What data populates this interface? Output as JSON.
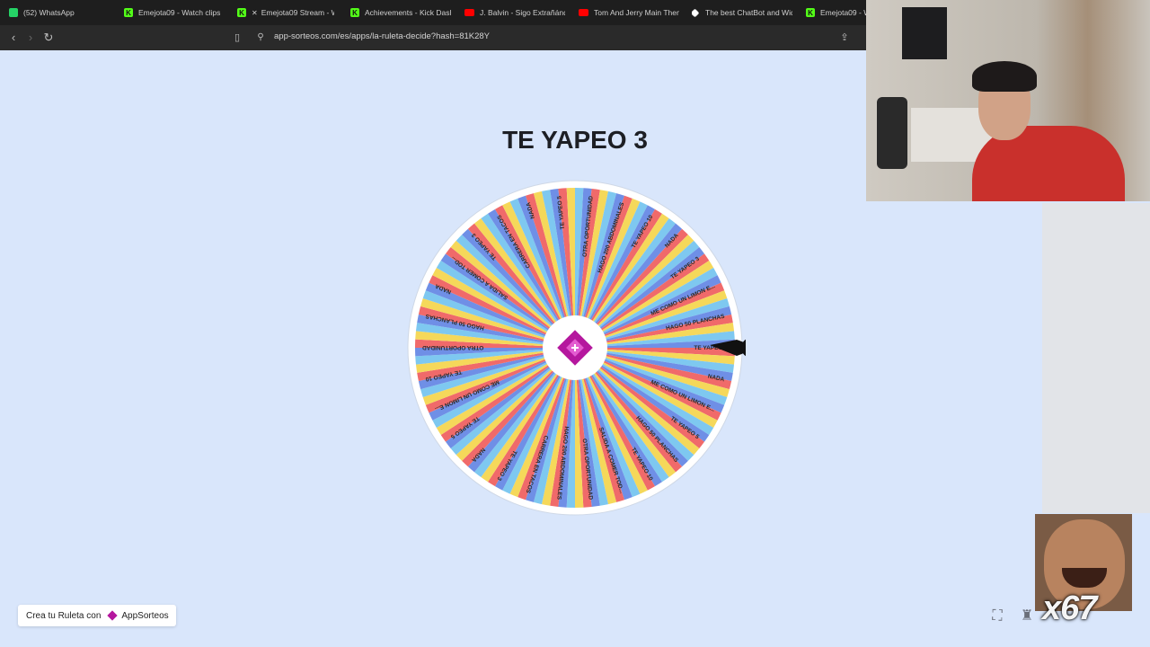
{
  "tabs": [
    {
      "label": "(52) WhatsApp",
      "icon": "whatsapp-icon",
      "color": "#25d366"
    },
    {
      "label": "Emejota09 - Watch clips o",
      "icon": "kick-icon",
      "color": "#53fc18"
    },
    {
      "label": "Emejota09 Stream - W",
      "icon": "kick-icon",
      "color": "#53fc18"
    },
    {
      "label": "Achievements - Kick Dash",
      "icon": "kick-icon",
      "color": "#53fc18"
    },
    {
      "label": "J. Balvin - Sigo Extrañándo",
      "icon": "youtube-icon",
      "color": "#ff0000"
    },
    {
      "label": "Tom And Jerry Main Them",
      "icon": "youtube-icon",
      "color": "#ff0000"
    },
    {
      "label": "The best ChatBot and Wid",
      "icon": "diamond-icon",
      "color": "#ffffff"
    },
    {
      "label": "Emejota09 - W",
      "icon": "kick-icon",
      "color": "#53fc18"
    }
  ],
  "address": {
    "url": "app-sorteos.com/es/apps/la-ruleta-decide?hash=81K28Y"
  },
  "page": {
    "title": "TE YAPEO 3",
    "badge_prefix": "Crea tu Ruleta con",
    "badge_brand": "AppSorteos"
  },
  "wheel": {
    "segment_colors": [
      "#f06a6a",
      "#f5d85a",
      "#7ec8f0",
      "#6f8fe6"
    ],
    "options": [
      "TE YAPEO 3",
      "NADA",
      "ME COMO UN LIMON E...",
      "TE YAPEO 5",
      "HAGO 50 PLANCHAS",
      "TE YAPEO 10",
      "SALIDA A COMER TOD...",
      "OTRA OPORTUNIDAD",
      "HAGO 200 ABDOMINALES",
      "CARRERA EN TACOS",
      "TE YAPEO 3",
      "NADA",
      "TE YAPEO 5",
      "ME COMO UN LIMON E...",
      "TE YAPEO 10",
      "OTRA OPORTUNIDAD",
      "HAGO 50 PLANCHAS",
      "NADA",
      "SALIDA A COMER TOD...",
      "TE YAPEO 3",
      "CARRERA EN TACOS",
      "NADA",
      "TE YAPEO 5",
      "OTRA OPORTUNIDAD",
      "HAGO 200 ABDOMINALES",
      "TE YAPEO 10",
      "NADA",
      "TE YAPEO 3",
      "ME COMO UN LIMON E...",
      "HAGO 50 PLANCHAS"
    ]
  },
  "stream_overlay": {
    "count": "x67"
  },
  "colors": {
    "accent": "#b5179e",
    "background": "#d9e6fb"
  }
}
